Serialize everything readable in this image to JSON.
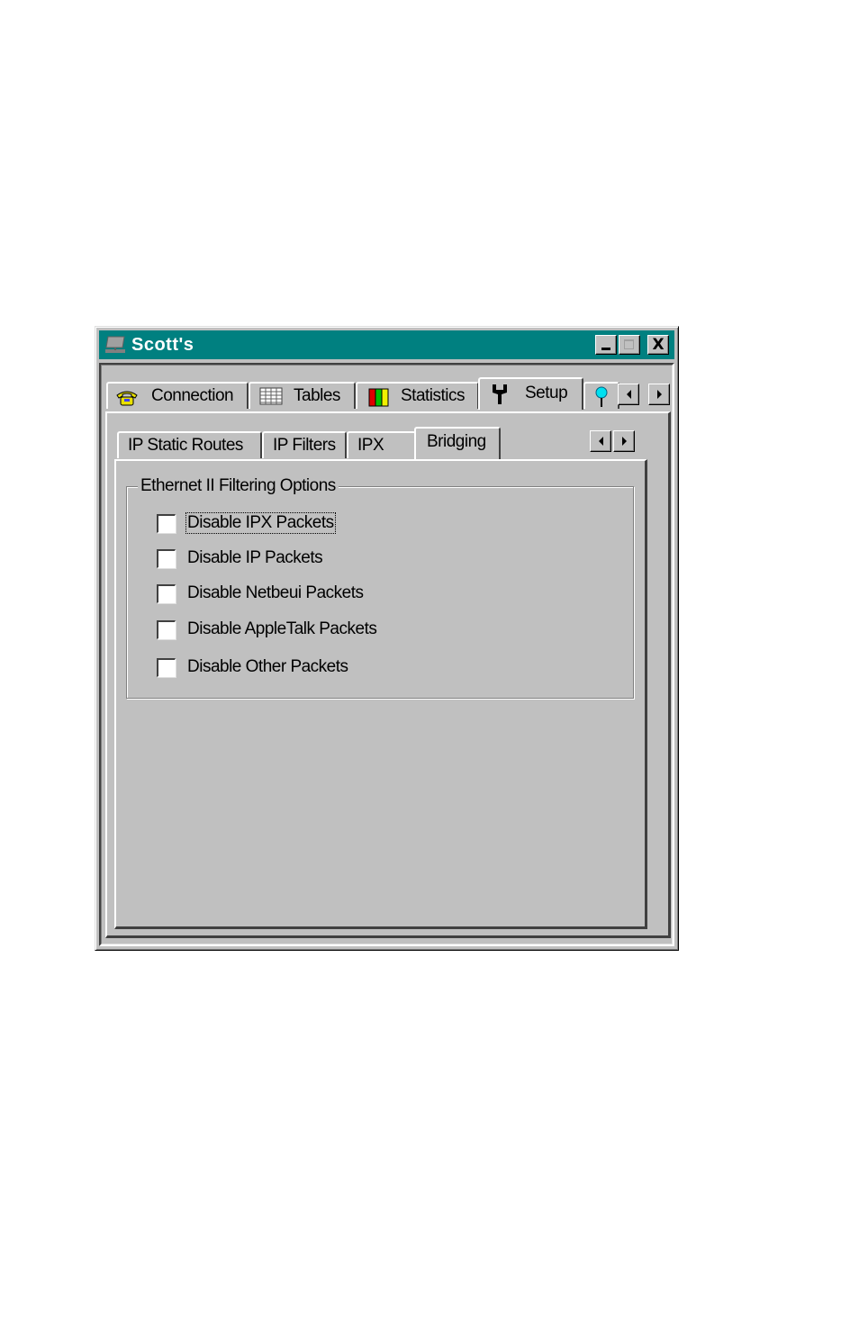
{
  "window": {
    "title": "Scott's",
    "controls": {
      "minimize": "minimize",
      "maximize": "maximize",
      "close": "X"
    },
    "maximize_disabled": true
  },
  "outer_tabs": [
    {
      "label": "Connection",
      "icon": "telephone-icon",
      "selected": false
    },
    {
      "label": "Tables",
      "icon": "table-grid-icon",
      "selected": false
    },
    {
      "label": "Statistics",
      "icon": "bar-chart-icon",
      "selected": false
    },
    {
      "label": "Setup",
      "icon": "wrench-icon",
      "selected": true
    },
    {
      "label": "",
      "icon": "pushpin-icon",
      "selected": false
    }
  ],
  "inner_tabs": [
    {
      "label": "IP Static Routes",
      "selected": false
    },
    {
      "label": "IP Filters",
      "selected": false
    },
    {
      "label": "IPX",
      "selected": false
    },
    {
      "label": "Bridging",
      "selected": true
    }
  ],
  "group": {
    "title": "Ethernet II Filtering Options",
    "options": [
      {
        "label": "Disable IPX Packets",
        "checked": false,
        "focused": true
      },
      {
        "label": "Disable IP Packets",
        "checked": false,
        "focused": false
      },
      {
        "label": "Disable Netbeui Packets",
        "checked": false,
        "focused": false
      },
      {
        "label": "Disable AppleTalk Packets",
        "checked": false,
        "focused": false
      },
      {
        "label": "Disable Other Packets",
        "checked": false,
        "focused": false
      }
    ]
  },
  "colors": {
    "titlebar": "#008080",
    "face": "#c0c0c0"
  }
}
